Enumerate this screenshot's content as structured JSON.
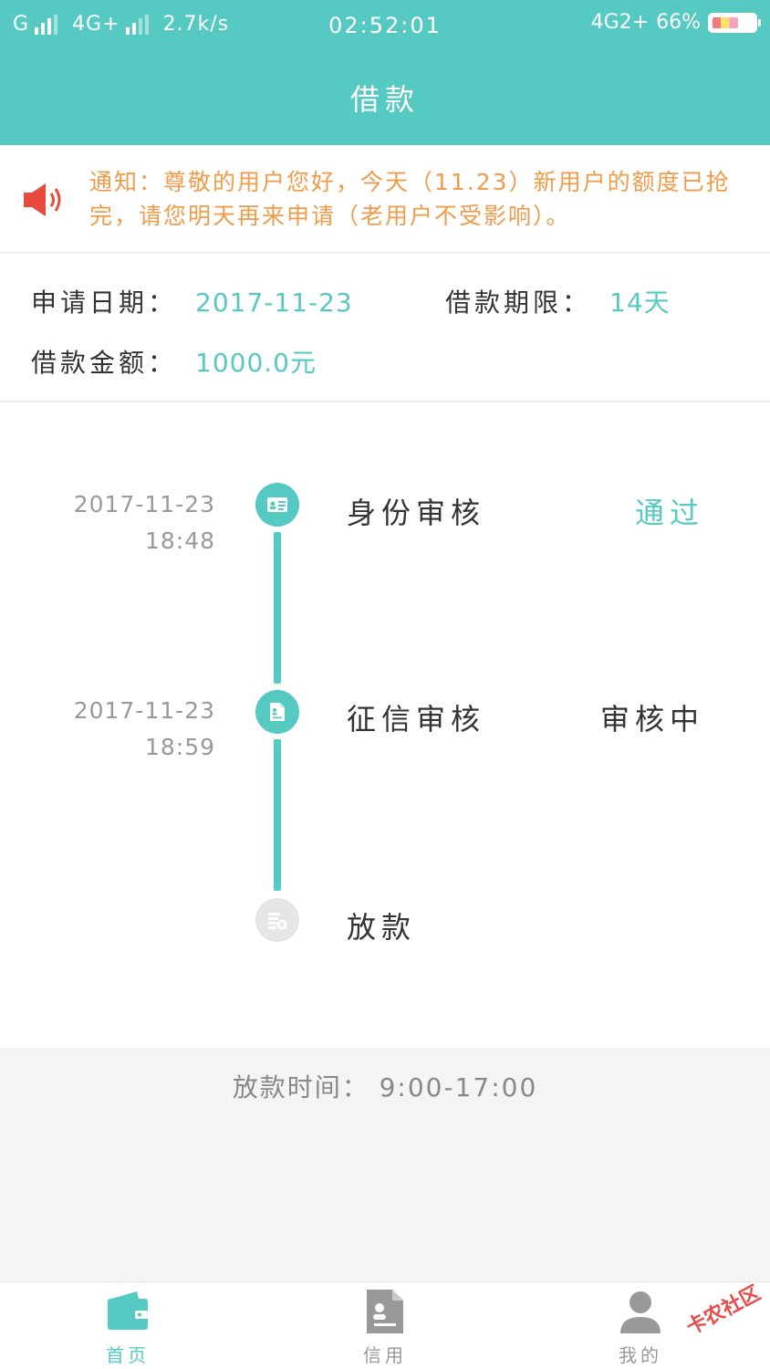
{
  "status_bar": {
    "carrier1": "G",
    "carrier2": "4G+",
    "speed": "2.7k/s",
    "time": "02:52:01",
    "network_right": "4G2+",
    "battery": "66%"
  },
  "header": {
    "title": "借款"
  },
  "notice": {
    "text": "通知：尊敬的用户您好，今天（11.23）新用户的额度已抢完，请您明天再来申请（老用户不受影响）。"
  },
  "info": {
    "apply_date_label": "申请日期：",
    "apply_date": "2017-11-23",
    "term_label": "借款期限：",
    "term": "14天",
    "amount_label": "借款金额：",
    "amount": "1000.0元"
  },
  "timeline": [
    {
      "date": "2017-11-23",
      "time": "18:48",
      "step": "身份审核",
      "status": "通过"
    },
    {
      "date": "2017-11-23",
      "time": "18:59",
      "step": "征信审核",
      "status": "审核中"
    },
    {
      "date": "",
      "time": "",
      "step": "放款",
      "status": ""
    }
  ],
  "disburse_time": "放款时间：  9:00-17:00",
  "nav": {
    "home": "首页",
    "credit": "信用",
    "mine": "我的"
  },
  "watermark": "卡农社区",
  "colors": {
    "primary": "#56c9c2",
    "notice": "#ef9b4a",
    "speaker": "#e64a3b"
  }
}
